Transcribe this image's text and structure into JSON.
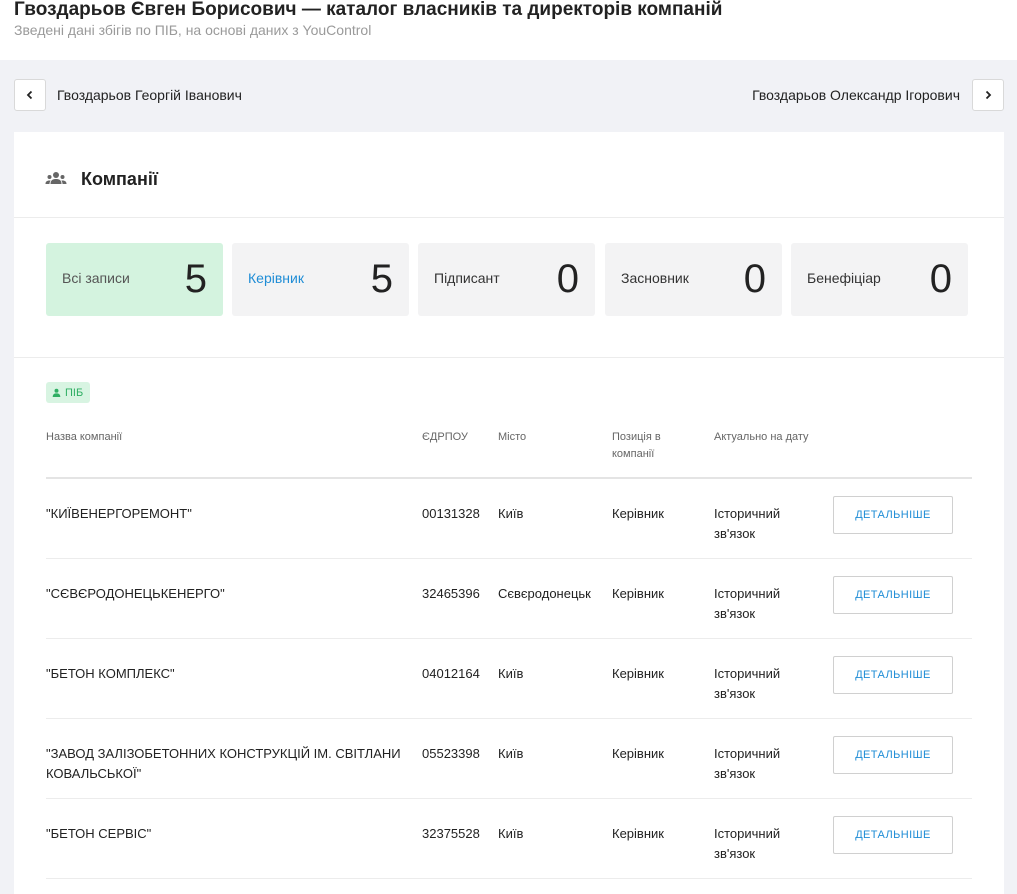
{
  "header": {
    "title": "Гвоздарьов Євген Борисович — каталог власників та директорів компаній",
    "subtitle": "Зведені дані збігів по ПІБ, на основі даних з YouControl"
  },
  "nav": {
    "prev_label": "Гвоздарьов Георгій Іванович",
    "next_label": "Гвоздарьов Олександр Ігорович"
  },
  "section": {
    "title": "Компанії"
  },
  "stats": [
    {
      "label": "Всі записи",
      "value": "5"
    },
    {
      "label": "Керівник",
      "value": "5"
    },
    {
      "label": "Підписант",
      "value": "0"
    },
    {
      "label": "Засновник",
      "value": "0"
    },
    {
      "label": "Бенефіціар",
      "value": "0"
    }
  ],
  "badge": {
    "label": "ПІБ"
  },
  "table": {
    "columns": [
      "Назва компанії",
      "ЄДРПОУ",
      "Місто",
      "Позиція в компанії",
      "Актуально на дату"
    ],
    "button_label": "ДЕТАЛЬНІШЕ",
    "rows": [
      {
        "name": "\"КИЇВЕНЕРГОРЕМОНТ\"",
        "code": "00131328",
        "city": "Київ",
        "position": "Керівник",
        "date": "Історичний зв'язок"
      },
      {
        "name": "\"СЄВЄРОДОНЕЦЬКЕНЕРГО\"",
        "code": "32465396",
        "city": "Сєвєродонецьк",
        "position": "Керівник",
        "date": "Історичний зв'язок"
      },
      {
        "name": "\"БЕТОН КОМПЛЕКС\"",
        "code": "04012164",
        "city": "Київ",
        "position": "Керівник",
        "date": "Історичний зв'язок"
      },
      {
        "name": "\"ЗАВОД ЗАЛІЗОБЕТОННИХ КОНСТРУКЦІЙ ІМ. СВІТЛАНИ КОВАЛЬСЬКОЇ\"",
        "code": "05523398",
        "city": "Київ",
        "position": "Керівник",
        "date": "Історичний зв'язок"
      },
      {
        "name": "\"БЕТОН СЕРВІС\"",
        "code": "32375528",
        "city": "Київ",
        "position": "Керівник",
        "date": "Історичний зв'язок"
      }
    ]
  },
  "colors": {
    "accent": "#1f8dd6",
    "active_stat_bg": "#d4f3df",
    "badge_green": "#2fae63"
  },
  "icons": {
    "prev": "chevron-left-icon",
    "next": "chevron-right-icon",
    "section": "users-group-icon",
    "badge": "person-icon"
  }
}
